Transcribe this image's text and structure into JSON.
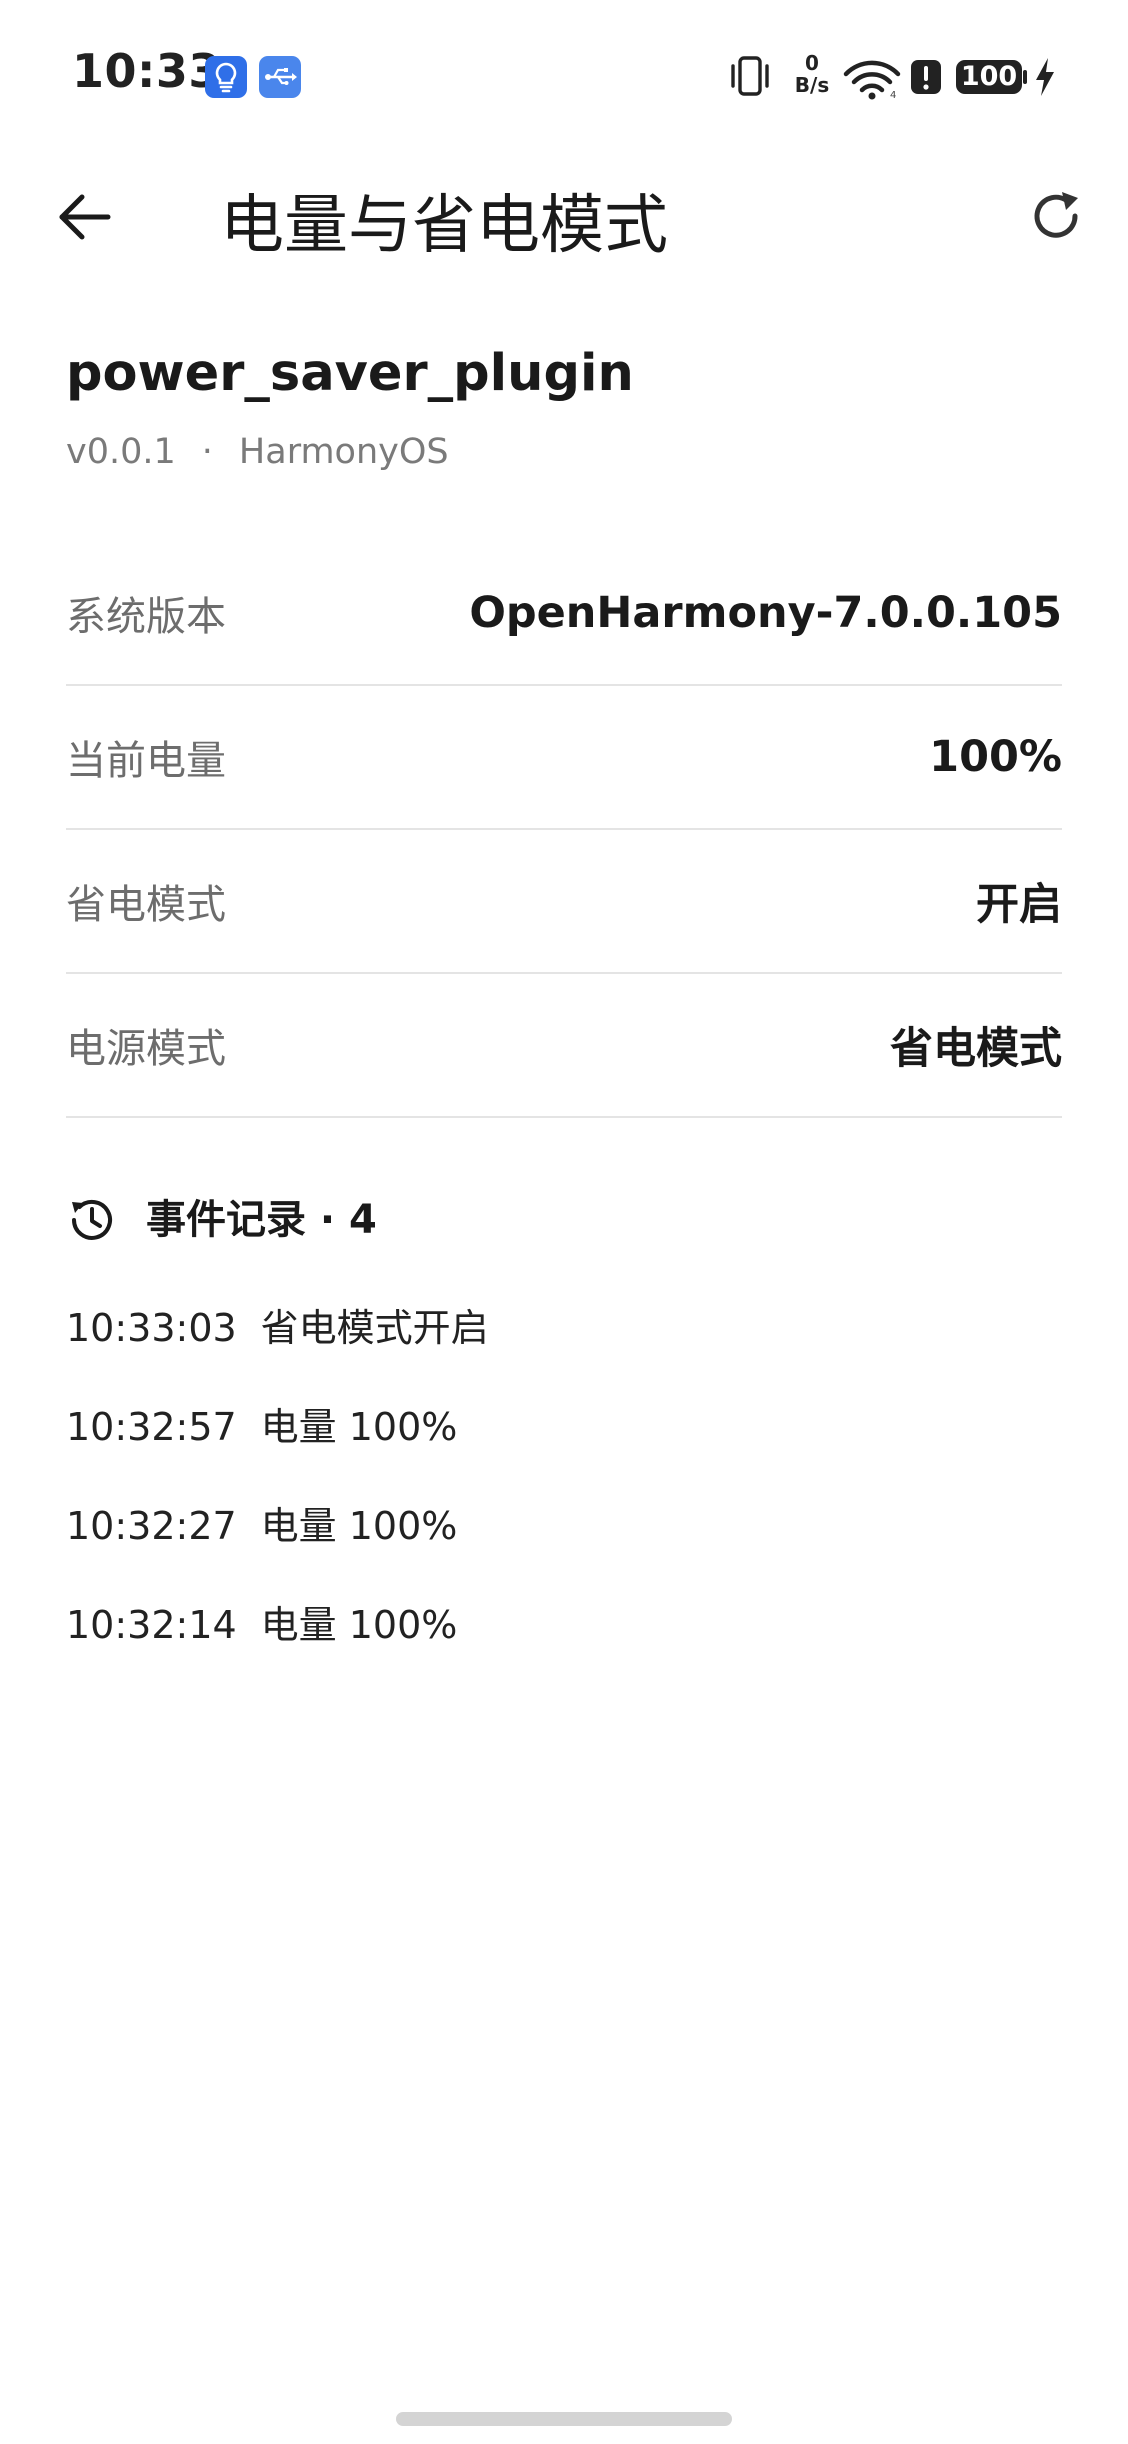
{
  "status_bar": {
    "time": "10:33",
    "net_speed_value": "0",
    "net_speed_unit": "B/s",
    "battery_level": "100",
    "icons": [
      "bulb-icon",
      "usb-icon",
      "vibrate-icon",
      "wifi-icon",
      "alert-icon",
      "battery-icon",
      "charging-bolt-icon"
    ],
    "colors": {
      "app_icon_bg": "#2f6fe8"
    }
  },
  "header": {
    "title": "电量与省电模式",
    "back_icon": "back-arrow-icon",
    "refresh_icon": "refresh-icon"
  },
  "plugin": {
    "name": "power_saver_plugin",
    "version": "v0.0.1",
    "separator": "·",
    "platform": "HarmonyOS"
  },
  "info_rows": [
    {
      "label": "系统版本",
      "value": "OpenHarmony-7.0.0.105"
    },
    {
      "label": "当前电量",
      "value": "100%"
    },
    {
      "label": "省电模式",
      "value": "开启"
    },
    {
      "label": "电源模式",
      "value": "省电模式"
    }
  ],
  "events": {
    "title": "事件记录 · 4",
    "icon": "history-icon",
    "items": [
      {
        "time": "10:33:03",
        "text": "省电模式开启"
      },
      {
        "time": "10:32:57",
        "text": "电量 100%"
      },
      {
        "time": "10:32:27",
        "text": "电量 100%"
      },
      {
        "time": "10:32:14",
        "text": "电量 100%"
      }
    ]
  }
}
